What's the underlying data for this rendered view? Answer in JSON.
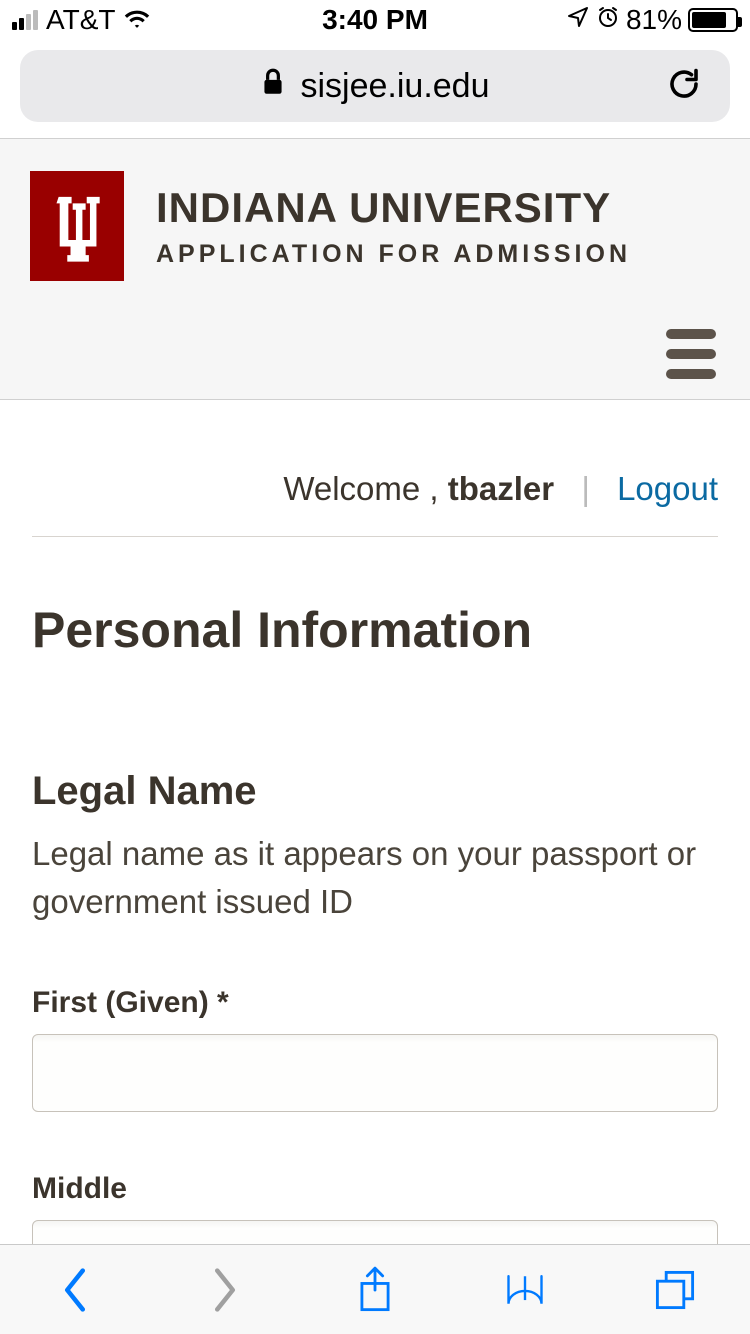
{
  "statusbar": {
    "carrier": "AT&T",
    "time": "3:40 PM",
    "battery_percent": "81%"
  },
  "browser": {
    "url": "sisjee.iu.edu"
  },
  "header": {
    "brand_title": "INDIANA UNIVERSITY",
    "brand_subtitle": "APPLICATION FOR ADMISSION"
  },
  "welcome": {
    "prefix": "Welcome ,",
    "username": "tbazler",
    "logout_label": "Logout"
  },
  "main": {
    "page_title": "Personal Information",
    "section_title": "Legal Name",
    "section_desc": "Legal name as it appears on your passport or government issued ID",
    "fields": {
      "first": {
        "label": "First (Given) *",
        "value": ""
      },
      "middle": {
        "label": "Middle",
        "value": ""
      }
    }
  }
}
